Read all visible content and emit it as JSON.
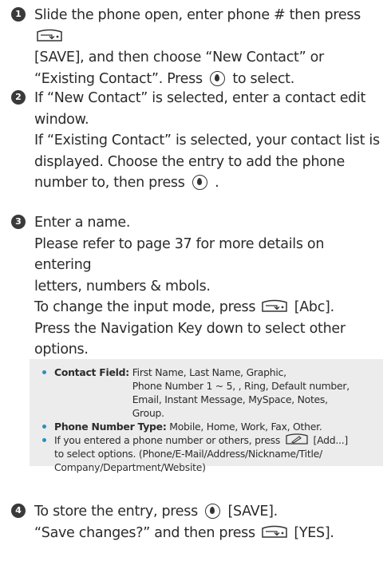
{
  "step1": {
    "num": "1",
    "line1a": "Slide the phone open, enter phone # then press",
    "line1b": "[SAVE], and then choose “New Contact” or",
    "line1c": "“Existing Contact”. Press",
    "line1d": "to select."
  },
  "step2": {
    "num": "2",
    "line1": "If “New Contact” is selected, enter a contact edit",
    "line2": "window.",
    "line3": "If “Existing Contact” is selected, your contact list is",
    "line4": "displayed. Choose the entry to add the phone",
    "line5a": "number to, then press",
    "line5b": "."
  },
  "step3": {
    "num": "3",
    "line1": "Enter a name.",
    "line2": "Please refer to page 37 for more details on entering",
    "line3": "letters, numbers & mbols.",
    "line4a": "To change the input mode, press",
    "line4b": "[Abc].",
    "line5": "Press the Navigation Key down to select other",
    "line6": "options."
  },
  "info": {
    "contact_field_label": "Contact Field:",
    "contact_field_line1": "First Name, Last Name, Graphic,",
    "contact_field_line2": "Phone Number 1 ~ 5, , Ring, Default number,",
    "contact_field_line3": "Email, Instant Message, MySpace, Notes,",
    "contact_field_line4": "Group.",
    "phone_type_label": "Phone Number Type:",
    "phone_type_values": "Mobile, Home, Work, Fax, Other.",
    "tip_a": "If you entered a phone number or others, press",
    "tip_b": "[Add...]",
    "tip_line2": "to select options. (Phone/E-Mail/Address/Nickname/Title/",
    "tip_line3": "Company/Department/Website)"
  },
  "step4": {
    "num": "4",
    "line1a": "To store the entry, press",
    "line1b": "[SAVE].",
    "line2a": "“Save changes?” and then press",
    "line2b": "[YES]."
  },
  "icons": {
    "softkey_right": "right-softkey-icon",
    "softkey_left": "left-softkey-icon",
    "ok": "ok-key-icon",
    "clear": "clear-key-icon"
  }
}
